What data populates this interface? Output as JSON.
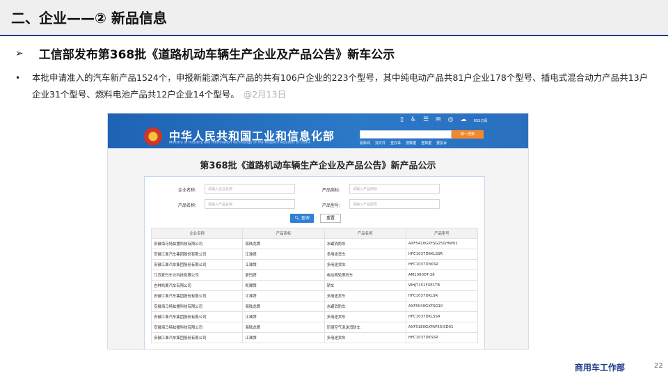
{
  "slide": {
    "section_title": "二、企业——② 新品信息",
    "headline_marker": "➢",
    "headline": "工信部发布第368批《道路机动车辆生产企业及产品公告》新车公示",
    "bullet_marker": "•",
    "bullet_text": "本批申请准入的汽车新产品1524个，申报新能源汽车产品的共有106户企业的223个型号，其中纯电动产品共81户企业178个型号、插电式混合动力产品共13户企业31个型号、燃料电池产品共12户企业14个型号。",
    "bullet_date": "@2月13日",
    "footer_brand": "商用车工作部",
    "page_number": "22"
  },
  "miit": {
    "site_title": "中华人民共和国工业和信息化部",
    "site_subtitle": "Ministry of Industry and Information Technology of the People's Republic of China",
    "rss_label": "RSS订阅",
    "search_button": "统一搜索",
    "nav": [
      "看新闻",
      "找文件",
      "查办事",
      "搜数据",
      "查数据",
      "要投诉"
    ],
    "page_heading": "第368批《道路机动车辆生产企业及产品公告》新产品公示",
    "form": {
      "company_label": "企业名称：",
      "company_placeholder": "请输入企业名称",
      "brand_label": "产品商标：",
      "brand_placeholder": "请输入产品商标",
      "product_label": "产品名称：",
      "product_placeholder": "请输入产品名称",
      "model_label": "产品型号：",
      "model_placeholder": "请输入产品型号",
      "query_button": "查询",
      "reset_button": "重置"
    },
    "table": {
      "headers": [
        "企业名称",
        "产品商标",
        "产品名称",
        "产品型号"
      ],
      "rows": [
        [
          "安徽海马特兹播科技有限公司",
          "海陆龙牌",
          "水罐消防车",
          "AXF5420GXFSG250/HW01"
        ],
        [
          "安徽江淮汽车集团股份有限公司",
          "江淮牌",
          "多用途货车",
          "HFC1037D6KLSSR"
        ],
        [
          "安徽江淮汽车集团股份有限公司",
          "江淮牌",
          "多用途货车",
          "HFC1037D3KSR"
        ],
        [
          "江苏爱玛车业科技有限公司",
          "爱玛牌",
          "电动两轮摩托车",
          "AM1000DT-38"
        ],
        [
          "吉林凯翼汽车有限公司",
          "凯翼牌",
          "轿车",
          "WHJ7151FXE1TB"
        ],
        [
          "安徽江淮汽车集团股份有限公司",
          "江淮牌",
          "多用途货车",
          "HFC1037DKLSR"
        ],
        [
          "安徽海马特兹播科技有限公司",
          "海陆龙牌",
          "水罐消防车",
          "AXF5040GXFSG10"
        ],
        [
          "安徽江淮汽车集团股份有限公司",
          "江淮牌",
          "多用途货车",
          "HFC1037DKLSSR"
        ],
        [
          "安徽海马特兹播科技有限公司",
          "海陆龙牌",
          "压缩空气泡沫消防车",
          "AXF5180GXFAP55/SD01"
        ],
        [
          "安徽江淮汽车集团股份有限公司",
          "江淮牌",
          "多用途货车",
          "HFC1037DKSSR"
        ]
      ]
    }
  }
}
